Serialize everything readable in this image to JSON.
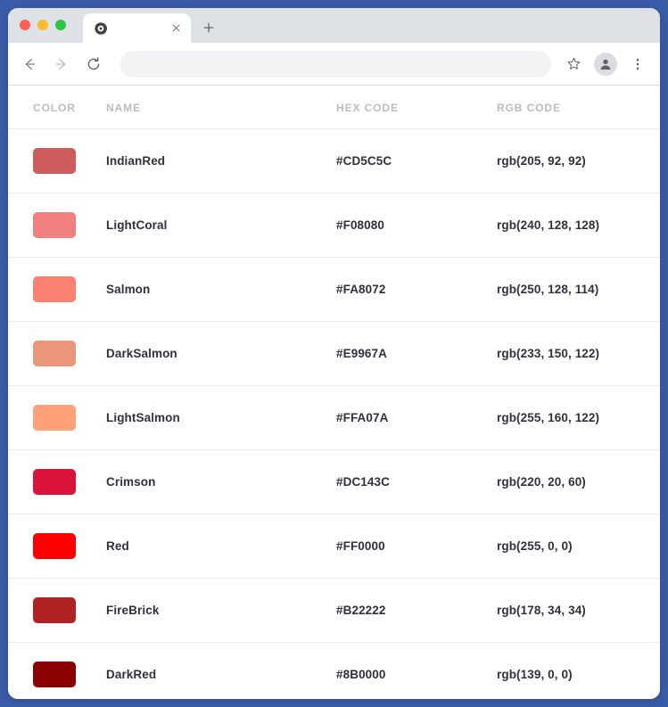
{
  "window": {
    "accent_background": "#3a5ca8",
    "traffic_lights": [
      "close",
      "minimize",
      "maximize"
    ]
  },
  "browser": {
    "tab": {
      "title": "",
      "favicon": "chrome-logo-icon",
      "close_label": "×"
    },
    "new_tab_label": "+",
    "toolbar": {
      "back_label": "←",
      "forward_label": "→",
      "reload_label": "↻",
      "address_value": "",
      "address_placeholder": "",
      "bookmark_icon": "star-icon",
      "profile_icon": "avatar-icon",
      "menu_icon": "three-dot-menu-icon"
    }
  },
  "table": {
    "headers": {
      "color": "COLOR",
      "name": "NAME",
      "hex": "HEX CODE",
      "rgb": "RGB CODE"
    },
    "rows": [
      {
        "name": "IndianRed",
        "hex": "#CD5C5C",
        "rgb": "rgb(205, 92, 92)",
        "swatch": "#CD5C5C"
      },
      {
        "name": "LightCoral",
        "hex": "#F08080",
        "rgb": "rgb(240, 128, 128)",
        "swatch": "#F08080"
      },
      {
        "name": "Salmon",
        "hex": "#FA8072",
        "rgb": "rgb(250, 128, 114)",
        "swatch": "#FA8072"
      },
      {
        "name": "DarkSalmon",
        "hex": "#E9967A",
        "rgb": "rgb(233, 150, 122)",
        "swatch": "#E9967A"
      },
      {
        "name": "LightSalmon",
        "hex": "#FFA07A",
        "rgb": "rgb(255, 160, 122)",
        "swatch": "#FFA07A"
      },
      {
        "name": "Crimson",
        "hex": "#DC143C",
        "rgb": "rgb(220, 20, 60)",
        "swatch": "#DC143C"
      },
      {
        "name": "Red",
        "hex": "#FF0000",
        "rgb": "rgb(255, 0, 0)",
        "swatch": "#FF0000"
      },
      {
        "name": "FireBrick",
        "hex": "#B22222",
        "rgb": "rgb(178, 34, 34)",
        "swatch": "#B22222"
      },
      {
        "name": "DarkRed",
        "hex": "#8B0000",
        "rgb": "rgb(139, 0, 0)",
        "swatch": "#8B0000"
      }
    ]
  }
}
